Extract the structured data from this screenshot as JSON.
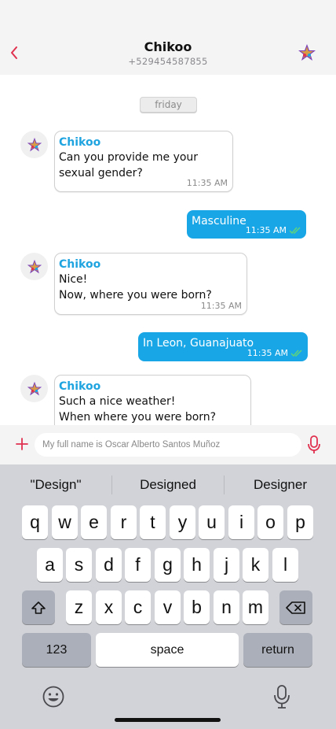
{
  "header": {
    "title": "Chikoo",
    "subtitle": "+529454587855",
    "back_icon": "chevron-left-icon",
    "avatar_icon": "star-logo-icon",
    "accent_color": "#e0314f"
  },
  "chat": {
    "date_label": "friday",
    "messages": [
      {
        "direction": "in",
        "sender": "Chikoo",
        "lines": [
          "Can you provide me your",
          "sexual gender?"
        ],
        "time": "11:35 AM"
      },
      {
        "direction": "out",
        "text": "Masculine",
        "time": "11:35 AM",
        "status": "read"
      },
      {
        "direction": "in",
        "sender": "Chikoo",
        "lines": [
          "Nice!",
          "Now, where you were born?"
        ],
        "time": "11:35 AM"
      },
      {
        "direction": "out",
        "text": "In Leon, Guanajuato",
        "time": "11:35 AM",
        "status": "read"
      },
      {
        "direction": "in",
        "sender": "Chikoo",
        "lines": [
          "Such a nice weather!",
          "When where you were born?"
        ],
        "time": ""
      }
    ],
    "sender_color": "#1fa4e0",
    "outgoing_color": "#19a6e6"
  },
  "composer": {
    "placeholder": "My full name is Oscar Alberto Santos Muñoz",
    "plus_icon": "plus-icon",
    "mic_icon": "microphone-icon"
  },
  "keyboard": {
    "suggestions": [
      "\"Design\"",
      "Designed",
      "Designer"
    ],
    "row1": [
      "q",
      "w",
      "e",
      "r",
      "t",
      "y",
      "u",
      "i",
      "o",
      "p"
    ],
    "row2": [
      "a",
      "s",
      "d",
      "f",
      "g",
      "h",
      "j",
      "k",
      "l"
    ],
    "row3": [
      "z",
      "x",
      "c",
      "v",
      "b",
      "n",
      "m"
    ],
    "numbers_label": "123",
    "space_label": "space",
    "return_label": "return",
    "shift_icon": "shift-icon",
    "delete_icon": "backspace-icon",
    "emoji_icon": "emoji-icon",
    "dictation_icon": "microphone-icon"
  }
}
